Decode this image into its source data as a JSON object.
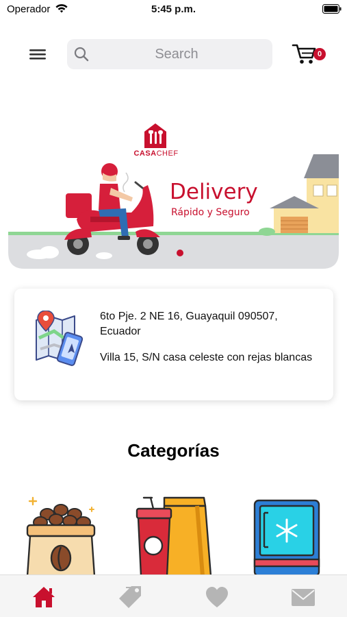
{
  "status_bar": {
    "carrier": "Operador",
    "time": "5:45 p.m."
  },
  "header": {
    "search_placeholder": "Search",
    "cart_count": "0"
  },
  "banner": {
    "brand_casa": "CASA",
    "brand_chef": "CHEF",
    "title": "Delivery",
    "subtitle": "Rápido y Seguro",
    "active_slide": 1
  },
  "address": {
    "line1": "6to Pje. 2 NE 16, Guayaquil 090507, Ecuador",
    "line2": "Villa 15, S/N casa celeste con rejas blancas"
  },
  "categories": {
    "title": "Categorías",
    "items": [
      {
        "icon": "coffee-bag-icon"
      },
      {
        "icon": "drinks-snacks-icon"
      },
      {
        "icon": "freezer-icon"
      }
    ]
  },
  "tab_bar": {
    "active": "home",
    "tabs": [
      "home-icon",
      "tag-icon",
      "heart-icon",
      "mail-icon"
    ]
  },
  "colors": {
    "brand_red": "#c8102e",
    "tab_inactive": "#b5b5b5",
    "search_bg": "#f0f0f2"
  }
}
